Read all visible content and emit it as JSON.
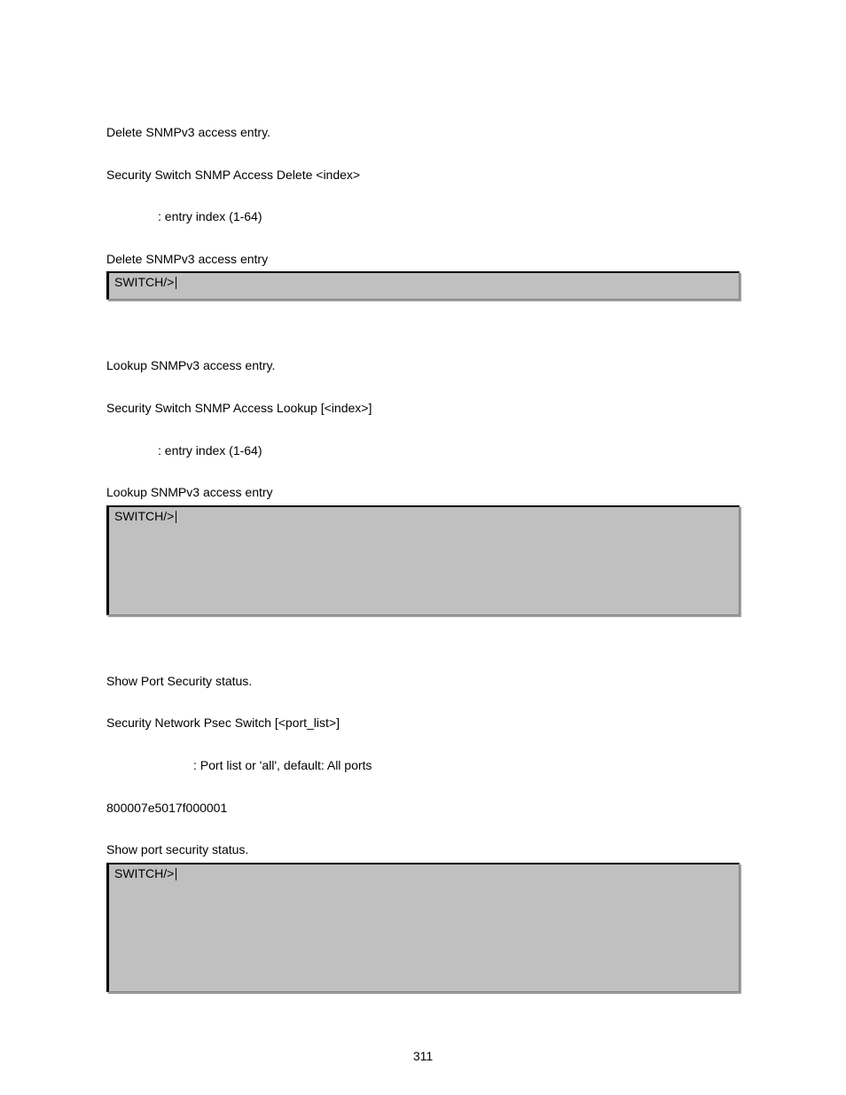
{
  "sections": [
    {
      "desc": "Delete SNMPv3 access entry.",
      "syntax": "Security Switch SNMP Access Delete <index>",
      "param": ": entry index (1-64)",
      "caption": "Delete SNMPv3 access entry",
      "caption_outdent": false,
      "terminal_prompt": "SWITCH/>",
      "terminal_size": "small",
      "show_value": false,
      "value": ""
    },
    {
      "desc": "Lookup SNMPv3 access entry.",
      "syntax": "Security Switch SNMP Access Lookup [<index>]",
      "param": ": entry index (1-64)",
      "caption": "Lookup SNMPv3 access entry",
      "caption_outdent": false,
      "terminal_prompt": "SWITCH/>",
      "terminal_size": "medium",
      "show_value": false,
      "value": ""
    },
    {
      "desc": "Show Port Security status.",
      "syntax": "Security Network Psec Switch [<port_list>]",
      "param": ": Port list or 'all', default: All ports",
      "caption": "Show port security status.",
      "caption_outdent": true,
      "terminal_prompt": "SWITCH/>",
      "terminal_size": "large",
      "show_value": true,
      "value": "800007e5017f000001"
    }
  ],
  "page_number": "311"
}
